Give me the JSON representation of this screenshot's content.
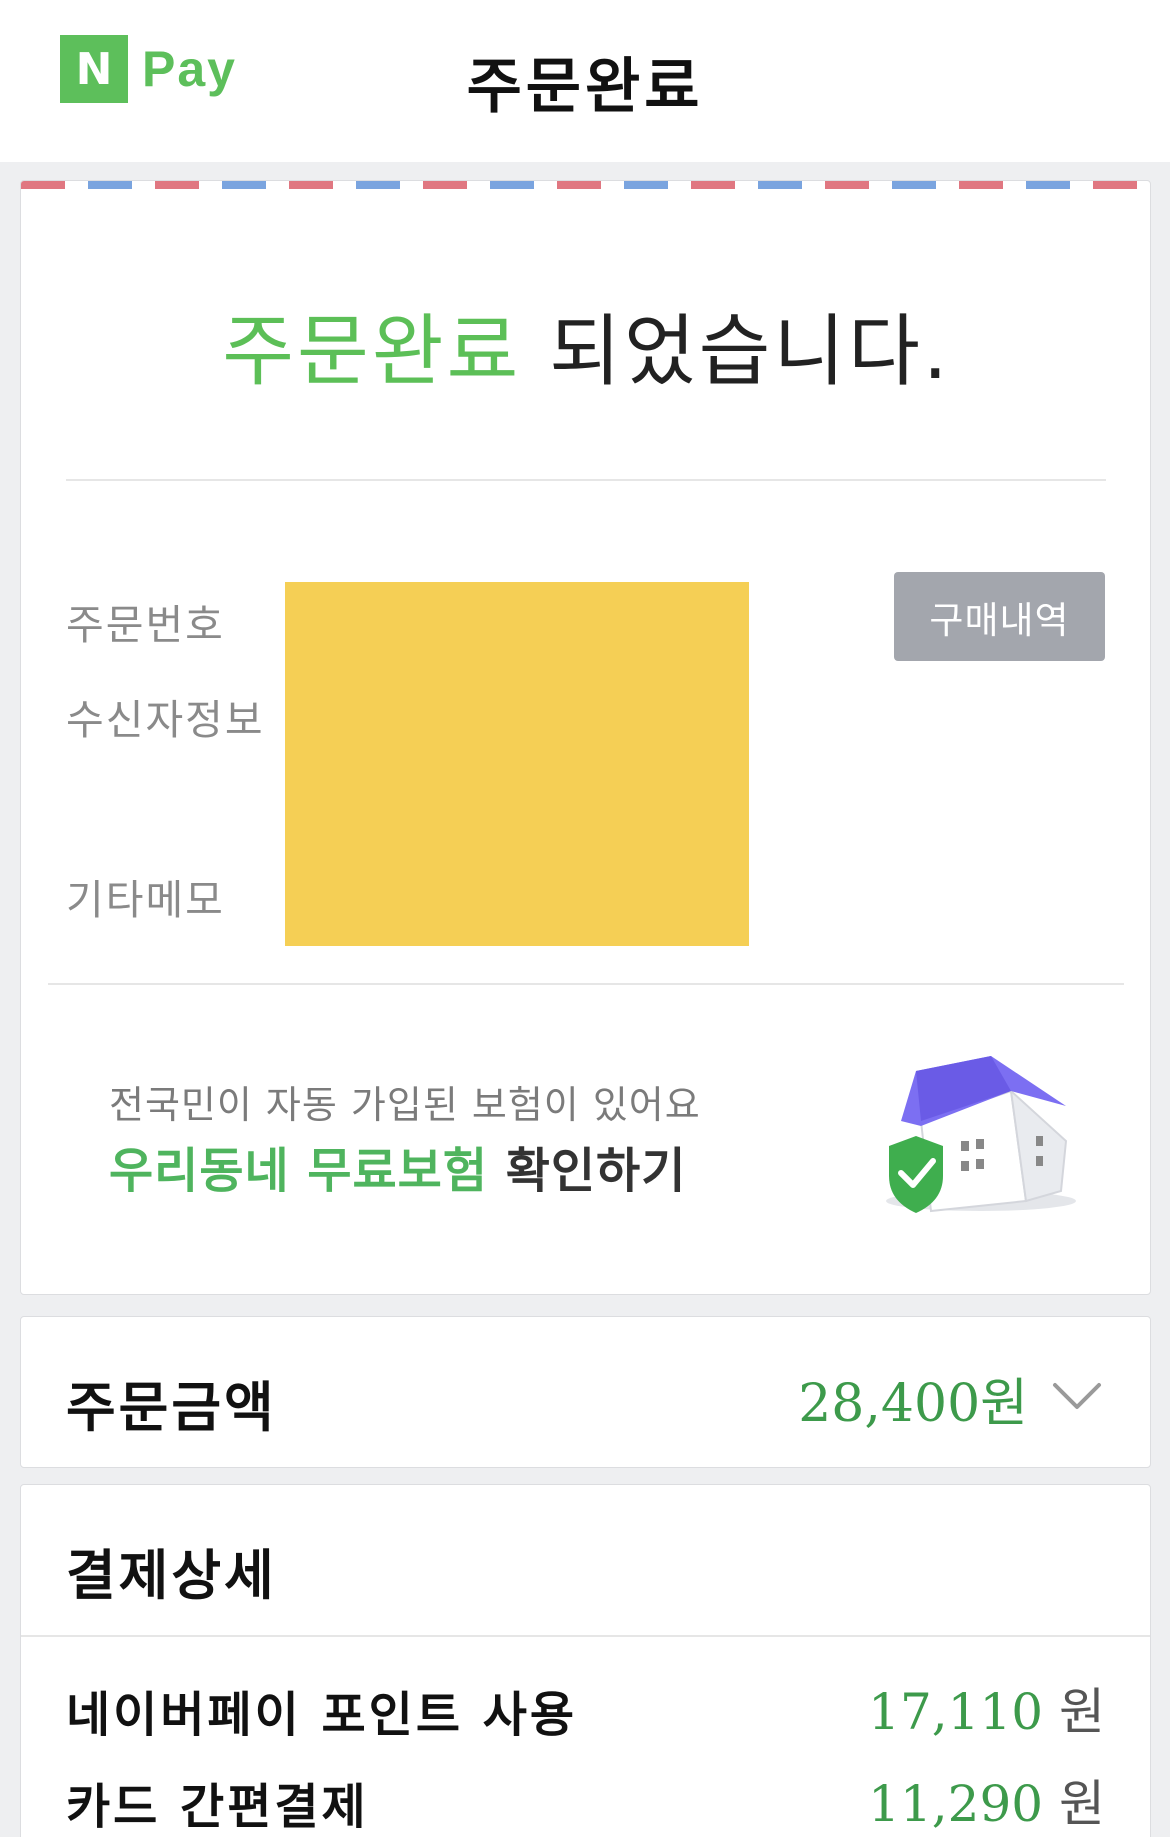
{
  "header": {
    "logo_n": "N",
    "logo_pay": "Pay",
    "title": "주문완료"
  },
  "confirmation": {
    "heading_highlight": "주문완료",
    "heading_rest": " 되었습니다.",
    "labels": {
      "order_number": "주문번호",
      "recipient_info": "수신자정보",
      "memo": "기타메모"
    },
    "purchase_history_button": "구매내역",
    "insurance": {
      "subtitle": "전국민이 자동 가입된 보험이 있어요",
      "highlight": "우리동네 무료보험",
      "action": " 확인하기",
      "icon": "house-shield-icon"
    }
  },
  "order_amount": {
    "label": "주문금액",
    "value": "28,400원",
    "icon": "chevron-down-icon"
  },
  "payment_detail": {
    "title": "결제상세",
    "rows": [
      {
        "label": "네이버페이 포인트 사용",
        "amount": "17,110",
        "unit": "원"
      },
      {
        "label": "카드 간편결제",
        "amount": "11,290",
        "unit": "원"
      }
    ]
  },
  "colors": {
    "brand_green": "#5cbf57",
    "amount_green": "#3d9a4b",
    "redaction": "#f5cf55",
    "button_gray": "#a3a6ad"
  }
}
